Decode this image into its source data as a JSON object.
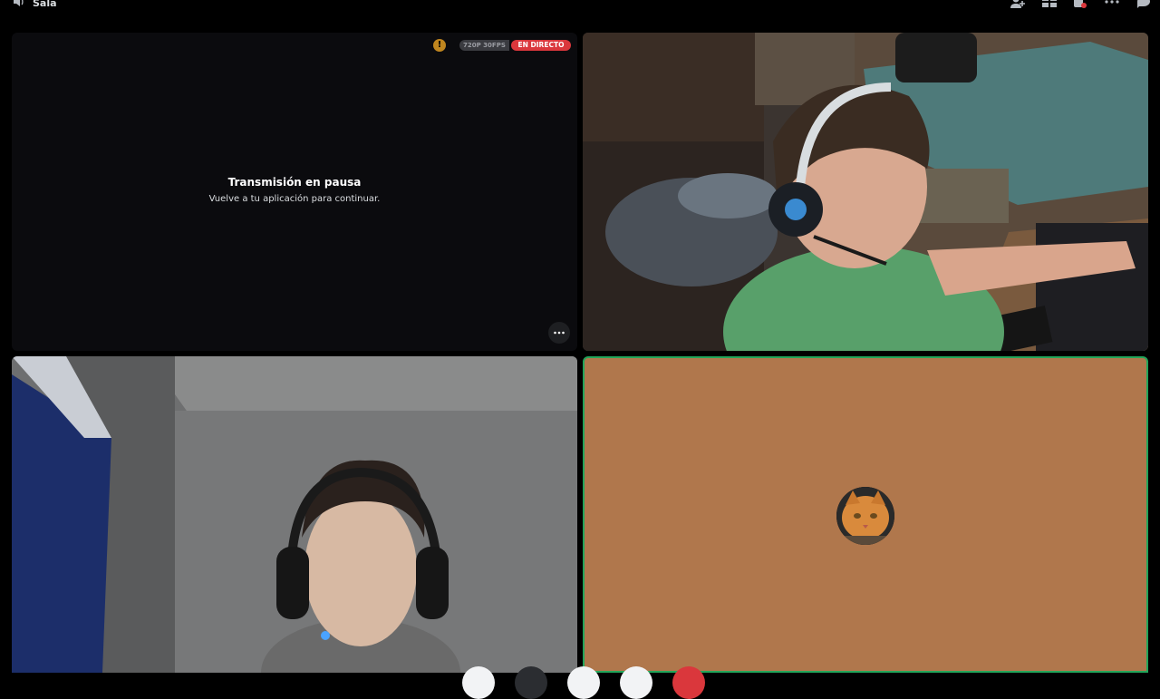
{
  "window": {
    "title": "Sala"
  },
  "stream_tile": {
    "paused_title": "Transmisión en pausa",
    "paused_subtitle": "Vuelve a tu aplicación para continuar.",
    "quality": "720P 30FPS",
    "live_label": "EN DIRECTO",
    "warning_icon": "warning-icon",
    "more_icon": "more-icon"
  },
  "top_icons": [
    "add-member-icon",
    "grid-layout-icon",
    "activities-icon",
    "more-icon",
    "chat-icon"
  ],
  "colors": {
    "live_red": "#da373c",
    "speaking_green": "#23a55a",
    "cat_tile_bg": "#b0774c",
    "warning_amber": "#c0861f"
  },
  "participants": [
    {
      "tile": "screen-share",
      "video": "paused"
    },
    {
      "tile": "camera",
      "video": "on"
    },
    {
      "tile": "camera",
      "video": "on"
    },
    {
      "tile": "avatar",
      "video": "off",
      "avatar": "orange cat avatar",
      "speaking": true
    }
  ]
}
